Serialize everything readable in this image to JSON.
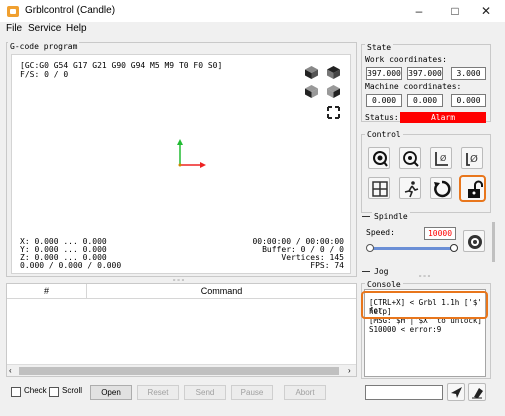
{
  "window": {
    "title": "Grblcontrol (Candle)",
    "minimize": "–",
    "maximize": "□",
    "close": "✕"
  },
  "menu": {
    "file": "File",
    "service": "Service",
    "help": "Help"
  },
  "gcode": {
    "group_title": "G-code program",
    "status_line": "[GC:G0 G54 G17 G21 G90 G94 M5 M9 T0 F0 S0]",
    "feed_line": "F/S: 0 / 0",
    "coords_left": [
      "X: 0.000 ... 0.000",
      "Y: 0.000 ... 0.000",
      "Z: 0.000 ... 0.000",
      "0.000 / 0.000 / 0.000"
    ],
    "coords_right": [
      "00:00:00 / 00:00:00",
      "Buffer: 0 / 0 / 0",
      "Vertices: 145",
      "FPS: 74"
    ]
  },
  "table": {
    "col_number": "#",
    "col_command": "Command"
  },
  "toolbar": {
    "check": "Check",
    "scroll": "Scroll",
    "open": "Open",
    "reset": "Reset",
    "send": "Send",
    "pause": "Pause",
    "abort": "Abort"
  },
  "state": {
    "group_title": "State",
    "work_label": "Work coordinates:",
    "work": [
      "397.000",
      "397.000",
      "3.000"
    ],
    "machine_label": "Machine coordinates:",
    "machine": [
      "0.000",
      "0.000",
      "0.000"
    ],
    "status_label": "Status:",
    "status_value": "Alarm",
    "alarm_color": "#ff0000"
  },
  "control": {
    "group_title": "Control",
    "buttons": [
      "home-icon",
      "zoom-icon",
      "z-probe-icon",
      "zero-z-icon",
      "zero-xy-icon",
      "run-icon",
      "reset-icon",
      "unlock-icon"
    ],
    "highlight_color": "#e8761c"
  },
  "spindle": {
    "group_title": "Spindle",
    "speed_label": "Speed:",
    "speed_value": "10000",
    "speed_color": "#ff0000",
    "slider_level": 1.0
  },
  "jog": {
    "group_title": "Jog"
  },
  "console": {
    "group_title": "Console",
    "lines": [
      "[CTRL+X] < Grbl 1.1h ['$' for",
      "help]",
      "[MSG:'$H'|'$X' to unlock]",
      "S10000 < error:9"
    ]
  }
}
